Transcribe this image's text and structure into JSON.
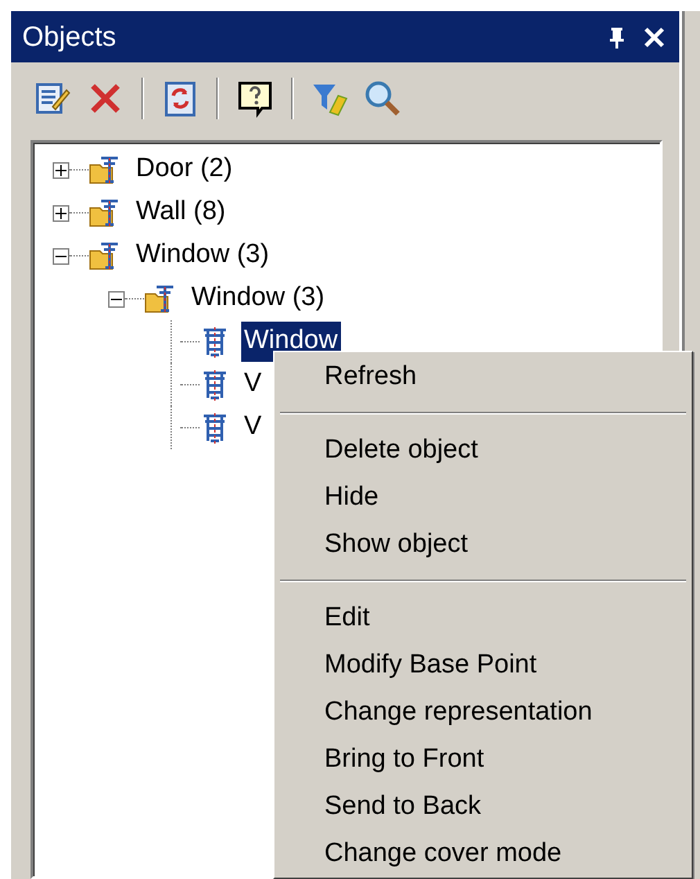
{
  "panel": {
    "title": "Objects"
  },
  "tree": [
    {
      "kind": "group",
      "label": "Door (2)",
      "expanded": false,
      "selected": false
    },
    {
      "kind": "group",
      "label": "Wall (8)",
      "expanded": false,
      "selected": false
    },
    {
      "kind": "group",
      "label": "Window (3)",
      "expanded": true,
      "selected": false,
      "children": [
        {
          "kind": "group",
          "label": "Window (3)",
          "expanded": true,
          "selected": false,
          "children": [
            {
              "kind": "object",
              "label": "Window",
              "selected": true
            },
            {
              "kind": "object",
              "label": "V",
              "selected": false
            },
            {
              "kind": "object",
              "label": "V",
              "selected": false
            }
          ]
        }
      ]
    }
  ],
  "context_menu": [
    {
      "kind": "item",
      "label": "Refresh"
    },
    {
      "kind": "separator"
    },
    {
      "kind": "item",
      "label": "Delete object"
    },
    {
      "kind": "item",
      "label": "Hide"
    },
    {
      "kind": "item",
      "label": "Show object"
    },
    {
      "kind": "separator"
    },
    {
      "kind": "item",
      "label": "Edit"
    },
    {
      "kind": "item",
      "label": "Modify Base Point"
    },
    {
      "kind": "item",
      "label": "Change representation"
    },
    {
      "kind": "item",
      "label": "Bring to Front"
    },
    {
      "kind": "item",
      "label": "Send to Back"
    },
    {
      "kind": "item",
      "label": "Change cover mode"
    }
  ]
}
